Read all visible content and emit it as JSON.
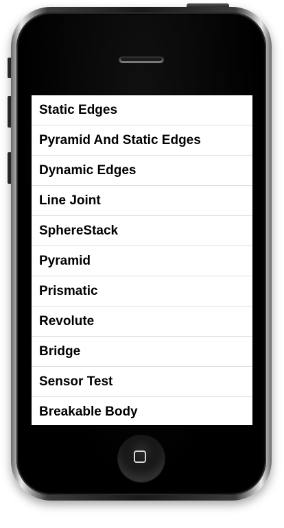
{
  "screen": {
    "items": [
      {
        "label": "Static Edges"
      },
      {
        "label": "Pyramid And Static Edges"
      },
      {
        "label": "Dynamic Edges"
      },
      {
        "label": "Line Joint"
      },
      {
        "label": "SphereStack"
      },
      {
        "label": "Pyramid"
      },
      {
        "label": "Prismatic"
      },
      {
        "label": "Revolute"
      },
      {
        "label": "Bridge"
      },
      {
        "label": "Sensor Test"
      },
      {
        "label": "Breakable Body"
      }
    ]
  },
  "icons": {
    "home_button": "home-button-icon",
    "speaker": "earpiece-speaker-icon"
  },
  "colors": {
    "phone_body": "#050505",
    "list_background": "#ffffff",
    "list_separator": "#e0e0e0",
    "list_text": "#000000"
  }
}
